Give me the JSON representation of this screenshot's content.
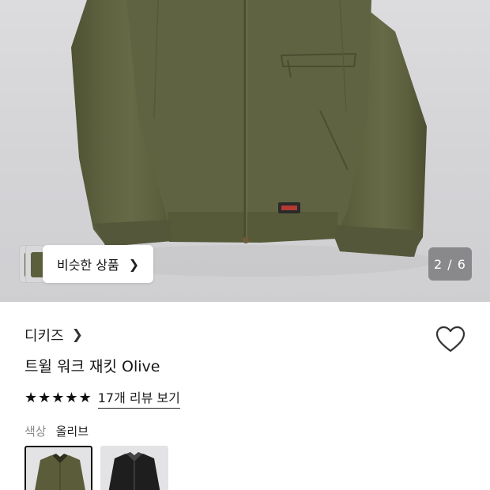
{
  "gallery": {
    "counter": "2 / 6",
    "similar_label": "비슷한 상품"
  },
  "product": {
    "brand": "디키즈",
    "title": "트윌 워크 재킷 Olive",
    "rating_stars": 5,
    "reviews_label": "17개 리뷰 보기",
    "color_label": "색상",
    "color_value": "올리브"
  },
  "swatches": [
    {
      "name": "olive",
      "selected": true,
      "color": "#5b5d3a"
    },
    {
      "name": "black",
      "selected": false,
      "color": "#1e1e1f"
    }
  ],
  "colors": {
    "jacket": "#5c5e3b",
    "background": "#d6d6d9"
  }
}
